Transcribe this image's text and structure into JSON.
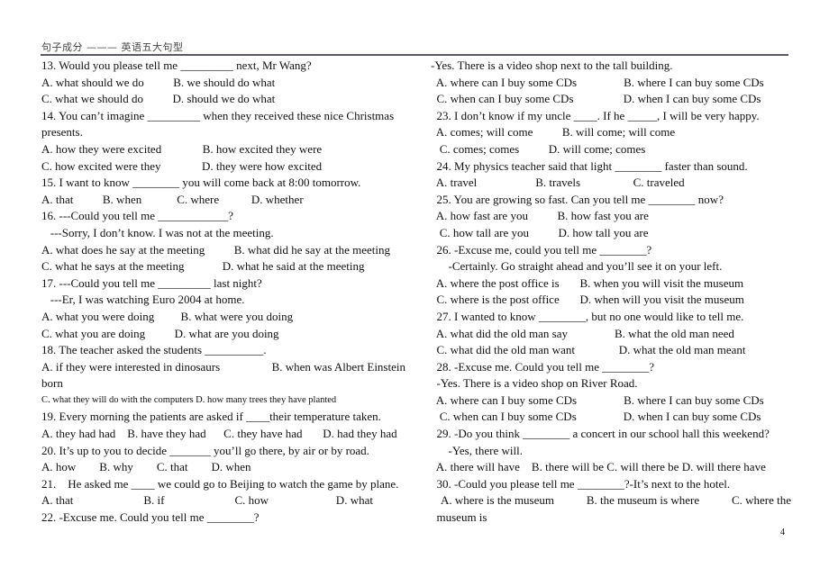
{
  "header": {
    "title": "句子成分 ——— 英语五大句型"
  },
  "left_column": {
    "lines": [
      {
        "text": "13. Would you please tell me _________ next, Mr Wang?"
      },
      {
        "text": "A. what should we do          B. we should do what"
      },
      {
        "text": "C. what we should do          D. should we do what"
      },
      {
        "text": "14. You can’t imagine _________ when they received these nice Christmas"
      },
      {
        "text": "presents."
      },
      {
        "text": "A. how they were excited              B. how excited they were"
      },
      {
        "text": "C. how excited were they              D. they were how excited"
      },
      {
        "text": "15. I want to know ________ you will come back at 8:00 tomorrow."
      },
      {
        "text": "A. that          B. when            C. where           D. whether"
      },
      {
        "text": "16. ---Could you tell me ____________?"
      },
      {
        "text": "   ---Sorry, I don’t know. I was not at the meeting."
      },
      {
        "text": "A. what does he say at the meeting          B. what did he say at the meeting"
      },
      {
        "text": "C. what he says at the meeting             D. what he said at the meeting"
      },
      {
        "text": "17. ---Could you tell me _________ last night?"
      },
      {
        "text": "   ---Er, I was watching Euro 2004 at home."
      },
      {
        "text": "A. what you were doing         B. what were you doing"
      },
      {
        "text": "C. what you are doing          D. what are you doing"
      },
      {
        "text": "18. The teacher asked the students __________."
      }
    ],
    "q18_option_ab": {
      "a": "A.  if  they  were  interested  in  dinosaurs",
      "b": "B.  when  was  Albert  Einstein"
    },
    "q18_born": "born",
    "q18_option_cd": "C. what they will do with the computers D. how many trees they have planted",
    "lines2": [
      {
        "text": "19. Every morning the patients are asked if ____their temperature taken."
      },
      {
        "text": "A. they had had    B. have they had      C. they have had       D. had they had"
      },
      {
        "text": "20. It’s up to you to decide _______ you’ll go there, by air or by road."
      },
      {
        "text": "A. how        B. why        C. that        D. when"
      },
      {
        "text": "21.    He asked me ____ we could go to Beijing to watch the game by plane."
      },
      {
        "text": "A. that                        B. if                        C. how                       D. what"
      },
      {
        "text": "22. -Excuse me. Could you tell me ________?"
      }
    ]
  },
  "right_column": {
    "lines": [
      {
        "text": "-Yes. There is a video shop next to the tall building."
      },
      {
        "text": "  A. where can I buy some CDs                B. where I can buy some CDs"
      },
      {
        "text": "  C. when can I buy some CDs                 D. when I can buy some CDs"
      },
      {
        "text": "  23. I don’t know if my uncle ____. If he _____, I will be very happy."
      },
      {
        "text": "  A. comes; will come          B. will come; will come"
      },
      {
        "text": "   C. comes; comes          D. will come; comes"
      },
      {
        "text": "  24. My physics teacher said that light ________ faster than sound."
      },
      {
        "text": "  A. travel                    B. travels                  C. traveled"
      },
      {
        "text": "  25. You are growing so fast. Can you tell me ________ now?"
      },
      {
        "text": "  A. how fast are you          B. how fast you are"
      },
      {
        "text": "   C. how tall are you          D. how tall you are"
      },
      {
        "text": "  26. -Excuse me, could you tell me ________?"
      },
      {
        "text": "      -Certainly. Go straight ahead and you’ll see it on your left."
      },
      {
        "text": "  A. where the post office is       B. when you will visit the museum"
      },
      {
        "text": "  C. where is the post office       D. when will you visit the museum"
      },
      {
        "text": "  27. I wanted to know ________, but no one would like to tell me."
      },
      {
        "text": "  A. what did the old man say                B. what the old man need"
      },
      {
        "text": "  C. what did the old man want               D. what the old man meant"
      },
      {
        "text": "  28. -Excuse me. Could you tell me ________?"
      },
      {
        "text": "  -Yes. There is a video shop on River Road."
      },
      {
        "text": "  A. where can I buy some CDs                B. where I can buy some CDs"
      },
      {
        "text": "   C. when can I buy some CDs                D. when I can buy some CDs"
      },
      {
        "text": "  29. -Do you think ________ a concert in our school hall this weekend?"
      },
      {
        "text": "      -Yes, there will."
      },
      {
        "text": "  A. there will have    B. there will be C. will there be D. will there have"
      },
      {
        "text": "  30. -Could you please tell me ________?-It’s next to the hotel."
      }
    ],
    "q30_options": {
      "a": "A.  where  is  the  museum",
      "b": "B.  the  museum  is  where",
      "c": "C.  where  the"
    },
    "q30_tail": "  museum is"
  },
  "footer": {
    "page_number": "4"
  }
}
